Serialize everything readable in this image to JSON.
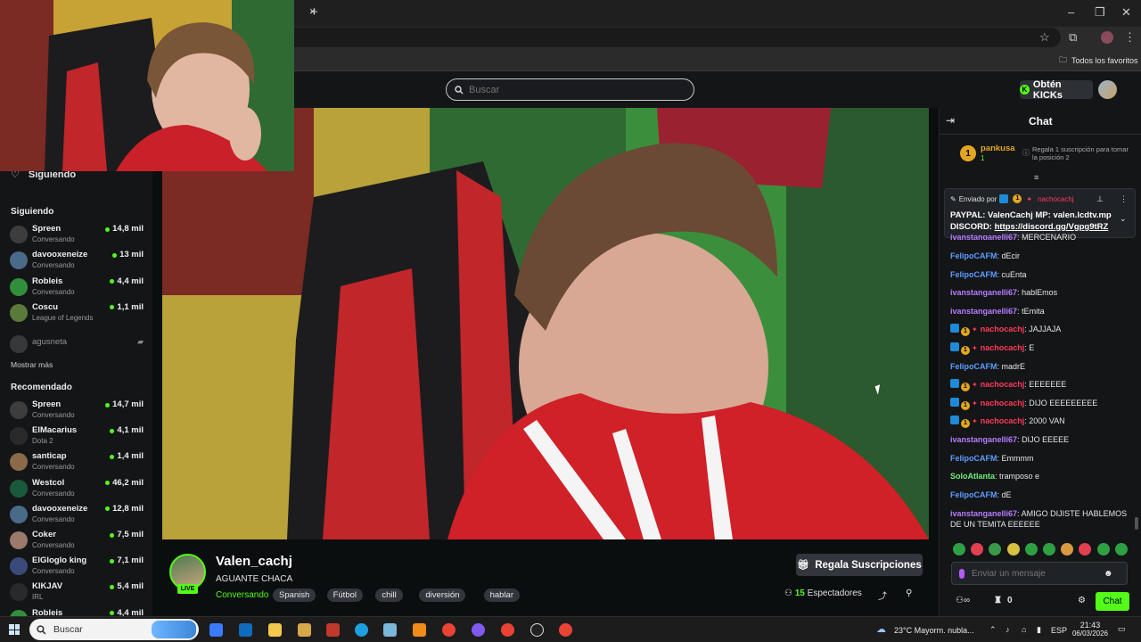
{
  "browser": {
    "bookmarks_folder": "Todos los favoritos"
  },
  "header": {
    "search_placeholder": "Buscar",
    "kicks_label": "Obtén KICKs"
  },
  "sidebar": {
    "following_main": "Siguiendo",
    "following_heading": "Siguiendo",
    "following": [
      {
        "name": "Spreen",
        "category": "Conversando",
        "viewers": "14,8 mil",
        "color": "#3d3d3d"
      },
      {
        "name": "davooxeneize",
        "category": "Conversando",
        "viewers": "13 mil",
        "color": "#4a6a8a"
      },
      {
        "name": "Robleis",
        "category": "Conversando",
        "viewers": "4,4 mil",
        "color": "#2f8f3a"
      },
      {
        "name": "Coscu",
        "category": "League of Legends",
        "viewers": "1,1 mil",
        "color": "#5a7a3a"
      }
    ],
    "offline": {
      "name": "agusneta"
    },
    "show_more": "Mostrar más",
    "recommended_heading": "Recomendado",
    "recommended": [
      {
        "name": "Spreen",
        "category": "Conversando",
        "viewers": "14,7 mil",
        "color": "#3d3d3d"
      },
      {
        "name": "ElMacarius",
        "category": "Dota 2",
        "viewers": "4,1 mil",
        "color": "#2a2a2a"
      },
      {
        "name": "santicap",
        "category": "Conversando",
        "viewers": "1,4 mil",
        "color": "#8a6a4a"
      },
      {
        "name": "Westcol",
        "category": "Conversando",
        "viewers": "46,2 mil",
        "color": "#1a5a3a"
      },
      {
        "name": "davooxeneize",
        "category": "Conversando",
        "viewers": "12,8 mil",
        "color": "#4a6a8a"
      },
      {
        "name": "Coker",
        "category": "Conversando",
        "viewers": "7,5 mil",
        "color": "#9a7a6a"
      },
      {
        "name": "ElGloglo king",
        "category": "Conversando",
        "viewers": "7,1 mil",
        "color": "#3a4a7a"
      },
      {
        "name": "KIKJAV",
        "category": "IRL",
        "viewers": "5,4 mil",
        "color": "#2a2a2a"
      },
      {
        "name": "Robleis",
        "category": "",
        "viewers": "4,4 mil",
        "color": "#2f8f3a"
      }
    ]
  },
  "stream": {
    "streamer": "Valen_cachj",
    "live": "LIVE",
    "title": "AGUANTE CHACA",
    "category": "Conversando",
    "tags": [
      "Spanish",
      "Fútbol",
      "chill",
      "diversión",
      "hablar"
    ],
    "gift_label": "Regala Suscripciones",
    "viewer_count": "15",
    "viewer_label": "Espectadores"
  },
  "chat": {
    "title": "Chat",
    "top_gifter": {
      "rank": "1",
      "name": "pankusa",
      "count": "1",
      "hint": "Regala 1 suscripción para tomar la posición 2"
    },
    "pinned": {
      "sent_by": "Enviado por",
      "author": "nachocachj",
      "line1": "PAYPAL: ValenCachj MP: valen.lcdtv.mp",
      "line2_prefix": "DISCORD: ",
      "line2_link": "https://discord.gg/Vgpg9tRZ"
    },
    "partial_line": {
      "user": "ivanstanganelli67",
      "text": "MERCENARIO"
    },
    "messages": [
      {
        "user": "FelipoCAFM",
        "text": "dEcir",
        "color": "blue",
        "badges": false
      },
      {
        "user": "FelipoCAFM",
        "text": "cuEnta",
        "color": "blue",
        "badges": false
      },
      {
        "user": "ivanstanganelli67",
        "text": "hablEmos",
        "color": "purple",
        "badges": false
      },
      {
        "user": "ivanstanganelli67",
        "text": "tEmita",
        "color": "purple",
        "badges": false
      },
      {
        "user": "nachocachj",
        "text": "JAJJAJA",
        "color": "red",
        "badges": true
      },
      {
        "user": "nachocachj",
        "text": "E",
        "color": "red",
        "badges": true
      },
      {
        "user": "FelipoCAFM",
        "text": "madrE",
        "color": "blue",
        "badges": false
      },
      {
        "user": "nachocachj",
        "text": "EEEEEEE",
        "color": "red",
        "badges": true
      },
      {
        "user": "nachocachj",
        "text": "DIJO EEEEEEEEE",
        "color": "red",
        "badges": true
      },
      {
        "user": "nachocachj",
        "text": "2000 VAN",
        "color": "red",
        "badges": true
      },
      {
        "user": "ivanstanganelli67",
        "text": "DIJO EEEEE",
        "color": "purple",
        "badges": false
      },
      {
        "user": "FelipoCAFM",
        "text": "Emmmm",
        "color": "blue",
        "badges": false
      },
      {
        "user": "SoloAtlanta",
        "text": "tramposo e",
        "color": "green",
        "badges": false
      },
      {
        "user": "FelipoCAFM",
        "text": "dE",
        "color": "blue",
        "badges": false
      }
    ],
    "last_message": {
      "user": "ivanstanganelli67",
      "text": "AMIGO DIJISTE HABLEMOS DE UN TEMITA EEEEEE"
    },
    "input_placeholder": "Enviar un mensaje",
    "points": "0",
    "send_label": "Chat"
  },
  "taskbar": {
    "search_label": "Buscar",
    "weather": "23°C  Mayorm. nubla...",
    "lang": "ESP",
    "time": "21:43",
    "date": "06/03/2026"
  },
  "colors": {
    "kick_green": "#53fc18",
    "background": "#0b0e0f",
    "panel": "#141517"
  }
}
